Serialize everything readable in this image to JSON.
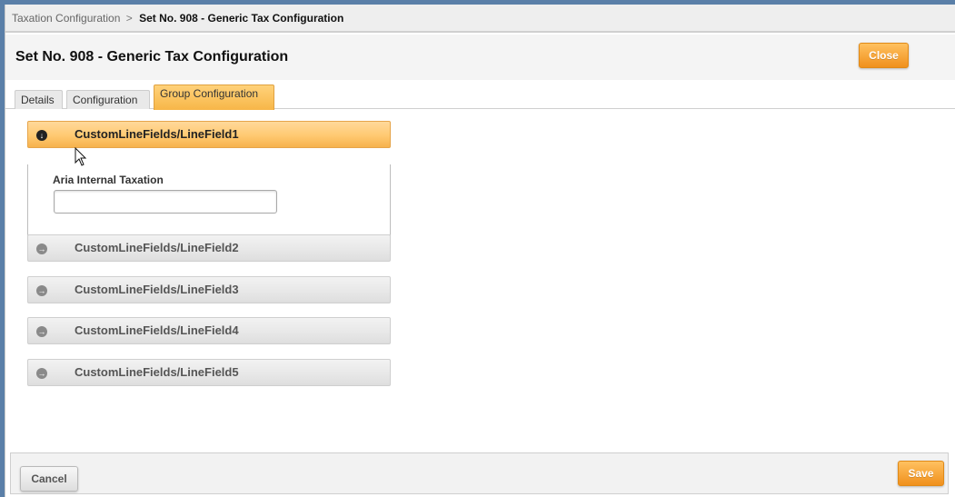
{
  "breadcrumb": {
    "parent": "Taxation Configuration",
    "separator": ">",
    "current": "Set No. 908 - Generic Tax Configuration"
  },
  "header": {
    "title": "Set No. 908 - Generic Tax Configuration",
    "close_label": "Close"
  },
  "tabs": [
    {
      "label": "Details",
      "active": false
    },
    {
      "label": "Configuration",
      "active": false
    },
    {
      "label": "Group Configuration",
      "active": true
    }
  ],
  "accordion": {
    "sections": [
      {
        "label": "CustomLineFields/LineField1",
        "expanded": true,
        "icon": "arrow-down-circle-icon"
      },
      {
        "label": "CustomLineFields/LineField2",
        "expanded": false,
        "icon": "arrow-right-circle-icon"
      },
      {
        "label": "CustomLineFields/LineField3",
        "expanded": false,
        "icon": "arrow-right-circle-icon"
      },
      {
        "label": "CustomLineFields/LineField4",
        "expanded": false,
        "icon": "arrow-right-circle-icon"
      },
      {
        "label": "CustomLineFields/LineField5",
        "expanded": false,
        "icon": "arrow-right-circle-icon"
      }
    ],
    "panel": {
      "field_label": "Aria Internal Taxation",
      "field_value": "",
      "field_placeholder": ""
    }
  },
  "footer": {
    "cancel_label": "Cancel",
    "save_label": "Save"
  },
  "colors": {
    "accent_orange": "#f7b648",
    "button_orange": "#f0901c",
    "background_chrome": "#5a7fa8"
  }
}
